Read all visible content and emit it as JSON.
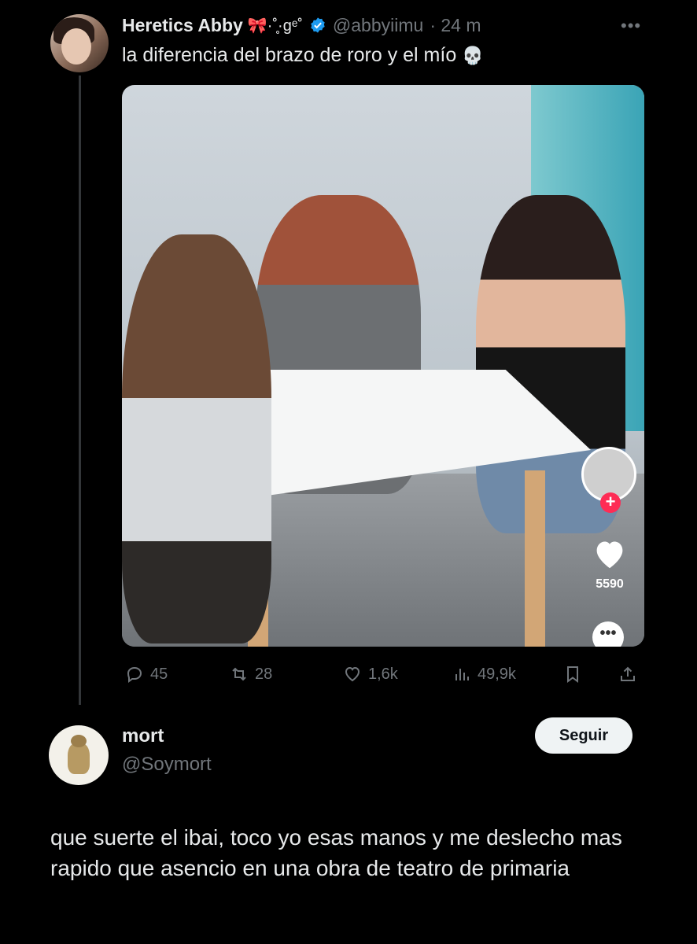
{
  "original_tweet": {
    "display_name": "Heretics Abby",
    "name_decoration": "🎀·˚̥·ɡᵉ˚",
    "handle": "@abbyiimu",
    "time": "· 24 m",
    "more_icon": "more-horizontal-icon",
    "text": "la diferencia del brazo de roro y el mío",
    "emoji": "skull-icon",
    "verified_icon": "verified-badge-icon",
    "media": {
      "type": "video-screenshot",
      "overlay_like_count": "5590",
      "overlay_plus": "+",
      "overlay_more": "•••"
    },
    "actions": {
      "replies": "45",
      "retweets": "28",
      "likes": "1,6k",
      "views": "49,9k"
    }
  },
  "reply": {
    "display_name": "mort",
    "handle": "@Soymort",
    "follow_label": "Seguir",
    "text": "que suerte el ibai, toco yo esas manos y me deslecho mas rapido que asencio en una obra de teatro de primaria"
  },
  "colors": {
    "background": "#000000",
    "text": "#e7e9ea",
    "muted": "#71767b",
    "verified": "#1d9bf0",
    "thread_line": "#333639"
  }
}
